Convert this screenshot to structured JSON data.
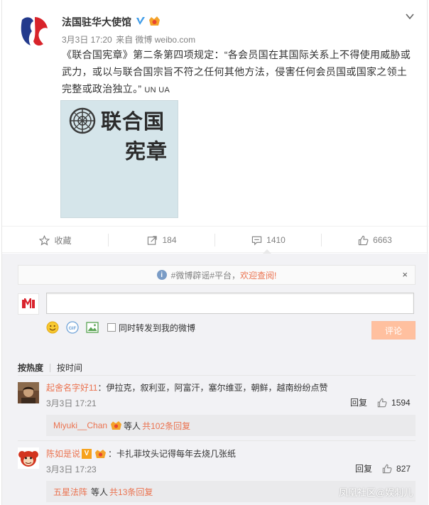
{
  "post": {
    "author": "法国驻华大使馆",
    "date": "3月3日 17:20",
    "source": "来自 微博 weibo.com",
    "text": "《联合国宪章》第二条第四项规定：“各会员国在其国际关系上不得使用威胁或武力，或以与联合国宗旨不符之任何其他方法，侵害任何会员国或国家之领土完整或政治独立。”",
    "tail": "UN UA",
    "image_line1": "联合国",
    "image_line2": "宪章"
  },
  "actions": {
    "favorite": "收藏",
    "forward_count": "184",
    "comment_count": "1410",
    "like_count": "6663"
  },
  "notice": {
    "text": "#微博辟谣#平台，",
    "link": "欢迎查阅!",
    "close": "×"
  },
  "composer": {
    "checkbox_label": "同时转发到我的微博",
    "submit_label": "评论"
  },
  "sort": {
    "hot": "按热度",
    "time": "按时间"
  },
  "comments": [
    {
      "name": "起舍名字好11",
      "text": "：伊拉克，叙利亚，阿富汗，塞尔维亚，朝鲜，越南纷纷点赞",
      "time": "3月3日 17:21",
      "reply": "回复",
      "likes": "1594",
      "replies_name": "Miyuki__Chan",
      "replies_mid": "等人",
      "replies_count": "共102条回复"
    },
    {
      "name": "陈如是说",
      "vip_letter": "V",
      "text": "：卡扎菲坟头记得每年去烧几张纸",
      "time": "3月3日 17:23",
      "reply": "回复",
      "likes": "827",
      "replies_name": "五星法阵",
      "replies_mid": "等人",
      "replies_count": "共13条回复"
    }
  ],
  "watermark": "凤凰社区@娱刺儿",
  "colors": {
    "accent": "#eb7350",
    "submit_disabled": "#ffc09f",
    "grey_bg": "#f2f2f5"
  }
}
